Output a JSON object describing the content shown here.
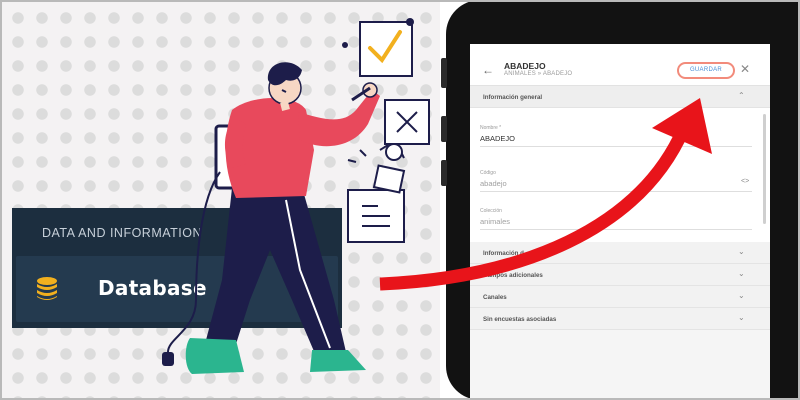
{
  "database_panel": {
    "section_title": "DATA AND INFORMATION",
    "item_label": "Database",
    "item_icon": "database-icon",
    "icon_color": "#f2b01e"
  },
  "app": {
    "header": {
      "back_icon": "arrow-left-icon",
      "title": "ABADEJO",
      "breadcrumb": "ANIMALES » ABADEJO",
      "save_label": "GUARDAR",
      "close_icon": "close-icon"
    },
    "general_section": {
      "label": "Información general",
      "state_icon": "chevron-up-icon"
    },
    "fields": [
      {
        "label": "Nombre *",
        "value": "ABADEJO"
      },
      {
        "label": "Código",
        "value": "abadejo"
      },
      {
        "label": "Colección",
        "value": "animales"
      }
    ],
    "collapsed_sections": [
      {
        "label": "Información d"
      },
      {
        "label": "Campos adicionales"
      },
      {
        "label": "Canales"
      },
      {
        "label": "Sin encuestas asociadas"
      }
    ]
  },
  "colors": {
    "panel_bg": "#1c2e3f",
    "panel_item_bg": "#243a4f",
    "arrow": "#e8141a",
    "save_border": "#f28b7b",
    "save_text": "#4a8fd6"
  }
}
